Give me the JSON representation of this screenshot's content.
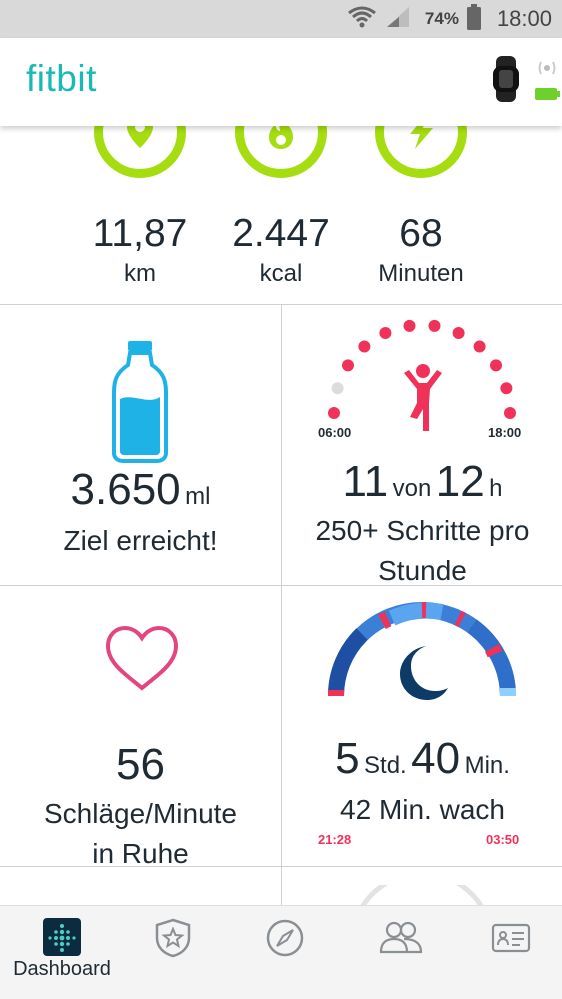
{
  "status_bar": {
    "battery": "74%",
    "time": "18:00"
  },
  "header": {
    "logo": "fitbit"
  },
  "stats": [
    {
      "value": "11,87",
      "unit": "km",
      "icon": "location-pin-icon"
    },
    {
      "value": "2.447",
      "unit": "kcal",
      "icon": "flame-icon"
    },
    {
      "value": "68",
      "unit": "Minuten",
      "icon": "lightning-icon"
    }
  ],
  "water": {
    "amount": "3.650",
    "unit": "ml",
    "status": "Ziel erreicht!"
  },
  "hourly": {
    "start": "06:00",
    "end": "18:00",
    "achieved": "11",
    "von": "von",
    "goal": "12",
    "unit": "h",
    "caption": "250+ Schritte pro",
    "caption_cut": "Stunde",
    "hours_active": 11,
    "hours_total": 12
  },
  "heart": {
    "value": "56",
    "unit": "Schläge/Minute",
    "caption_cut": "in Ruhe"
  },
  "sleep": {
    "start": "21:28",
    "end": "03:50",
    "hours": "5",
    "hours_unit": "Std.",
    "minutes": "40",
    "minutes_unit": "Min.",
    "awake": "42 Min. wach"
  },
  "nav": [
    {
      "label": "Dashboard",
      "icon": "dashboard-icon"
    },
    {
      "label": "",
      "icon": "challenges-icon"
    },
    {
      "label": "",
      "icon": "discover-compass-icon"
    },
    {
      "label": "",
      "icon": "friends-icon"
    },
    {
      "label": "",
      "icon": "account-card-icon"
    }
  ],
  "colors": {
    "accent": "#1ab8b6",
    "ring": "#a5dd10",
    "pink": "#f0325a",
    "water": "#1fb2e6",
    "heart": "#e5457f",
    "sleep_dark": "#0d3b66"
  }
}
